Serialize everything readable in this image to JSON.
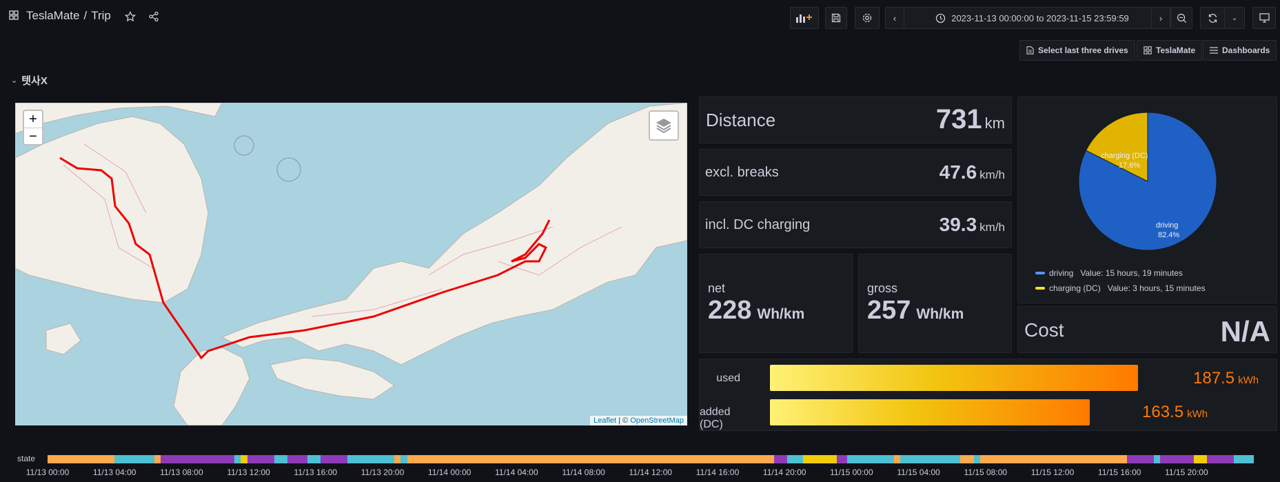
{
  "header": {
    "app": "TeslaMate",
    "separator": "/",
    "page": "Trip",
    "time_range": "2023-11-13 00:00:00 to 2023-11-15 23:59:59"
  },
  "links": {
    "select_last": "Select last three drives",
    "teslamate": "TeslaMate",
    "dashboards": "Dashboards"
  },
  "row": {
    "title": "텟사X"
  },
  "map": {
    "zoom_in": "+",
    "zoom_out": "−",
    "attribution_leaflet": "Leaflet",
    "attribution_sep": " | © ",
    "attribution_osm": "OpenStreetMap"
  },
  "stats": {
    "distance_label": "Distance",
    "distance_value": "731",
    "distance_unit": "km",
    "excl_label": "excl. breaks",
    "excl_value": "47.6",
    "excl_unit": "km/h",
    "incl_label": "incl. DC charging",
    "incl_value": "39.3",
    "incl_unit": "km/h",
    "net_label": "net",
    "net_value": "228",
    "net_unit": "Wh/km",
    "gross_label": "gross",
    "gross_value": "257",
    "gross_unit": "Wh/km",
    "cost_label": "Cost",
    "cost_value": "N/A"
  },
  "pie": {
    "slices": [
      {
        "name": "driving",
        "percent": "82.4%",
        "value_text": "Value: 15 hours, 19 minutes",
        "fraction": 0.824,
        "color": "#1f60c4"
      },
      {
        "name": "charging (DC)",
        "percent": "17.6%",
        "value_text": "Value: 3 hours, 15 minutes",
        "fraction": 0.176,
        "color": "#e0b400"
      }
    ]
  },
  "energy": {
    "used_label": "used",
    "used_value": "187.5",
    "used_unit": "kWh",
    "used_fraction": 0.92,
    "added_label": "added (DC)",
    "added_value": "163.5",
    "added_unit": "kWh",
    "added_fraction": 0.8
  },
  "timeline": {
    "label": "state",
    "ticks": [
      "11/13 00:00",
      "11/13 04:00",
      "11/13 08:00",
      "11/13 12:00",
      "11/13 16:00",
      "11/13 20:00",
      "11/14 00:00",
      "11/14 04:00",
      "11/14 08:00",
      "11/14 12:00",
      "11/14 16:00",
      "11/14 20:00",
      "11/15 00:00",
      "11/15 04:00",
      "11/15 08:00",
      "11/15 12:00",
      "11/15 16:00",
      "11/15 20:00"
    ],
    "colors": {
      "online": "#ffa94d",
      "asleep": "#4dc0d3",
      "driving": "#8f3bb8",
      "charging": "#f2cc0c"
    }
  }
}
